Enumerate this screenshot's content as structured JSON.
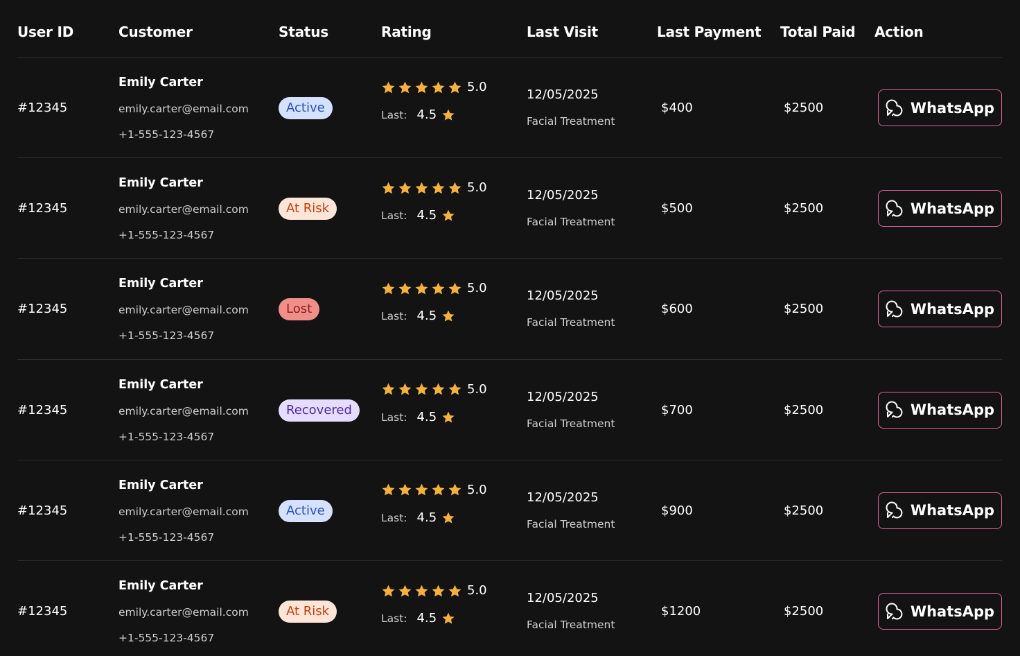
{
  "headers": {
    "user_id": "User ID",
    "customer": "Customer",
    "status": "Status",
    "rating": "Rating",
    "last_visit": "Last Visit",
    "last_payment": "Last Payment",
    "total_paid": "Total Paid",
    "action": "Action"
  },
  "status_styles": {
    "Active": {
      "bg": "#d5e2ff",
      "fg": "#2a4fb8"
    },
    "At Risk": {
      "bg": "#fde5d8",
      "fg": "#c2410c"
    },
    "Lost": {
      "bg": "#f08f8a",
      "fg": "#8b1d1d"
    },
    "Recovered": {
      "bg": "#e6dcff",
      "fg": "#4b2a9a"
    }
  },
  "colors": {
    "background": "#131313",
    "divider": "#2e2e2e",
    "star": "#f4b13e",
    "whatsapp_border": "#e0649b"
  },
  "rows": [
    {
      "user_id": "#12345",
      "name": "Emily Carter",
      "email": "emily.carter@email.com",
      "phone": "+1-555-123-4567",
      "status": "Active",
      "rating": "5.0",
      "last_label": "Last:",
      "last_rating": "4.5",
      "visit_date": "12/05/2025",
      "visit_type": "Facial Treatment",
      "last_payment": "$400",
      "total_paid": "$2500",
      "action_label": "WhatsApp",
      "action_icon": "whatsapp-icon"
    },
    {
      "user_id": "#12345",
      "name": "Emily Carter",
      "email": "emily.carter@email.com",
      "phone": "+1-555-123-4567",
      "status": "At Risk",
      "rating": "5.0",
      "last_label": "Last:",
      "last_rating": "4.5",
      "visit_date": "12/05/2025",
      "visit_type": "Facial Treatment",
      "last_payment": "$500",
      "total_paid": "$2500",
      "action_label": "WhatsApp",
      "action_icon": "whatsapp-icon"
    },
    {
      "user_id": "#12345",
      "name": "Emily Carter",
      "email": "emily.carter@email.com",
      "phone": "+1-555-123-4567",
      "status": "Lost",
      "rating": "5.0",
      "last_label": "Last:",
      "last_rating": "4.5",
      "visit_date": "12/05/2025",
      "visit_type": "Facial Treatment",
      "last_payment": "$600",
      "total_paid": "$2500",
      "action_label": "WhatsApp",
      "action_icon": "whatsapp-icon"
    },
    {
      "user_id": "#12345",
      "name": "Emily Carter",
      "email": "emily.carter@email.com",
      "phone": "+1-555-123-4567",
      "status": "Recovered",
      "rating": "5.0",
      "last_label": "Last:",
      "last_rating": "4.5",
      "visit_date": "12/05/2025",
      "visit_type": "Facial Treatment",
      "last_payment": "$700",
      "total_paid": "$2500",
      "action_label": "WhatsApp",
      "action_icon": "whatsapp-icon"
    },
    {
      "user_id": "#12345",
      "name": "Emily Carter",
      "email": "emily.carter@email.com",
      "phone": "+1-555-123-4567",
      "status": "Active",
      "rating": "5.0",
      "last_label": "Last:",
      "last_rating": "4.5",
      "visit_date": "12/05/2025",
      "visit_type": "Facial Treatment",
      "last_payment": "$900",
      "total_paid": "$2500",
      "action_label": "WhatsApp",
      "action_icon": "whatsapp-icon"
    },
    {
      "user_id": "#12345",
      "name": "Emily Carter",
      "email": "emily.carter@email.com",
      "phone": "+1-555-123-4567",
      "status": "At Risk",
      "rating": "5.0",
      "last_label": "Last:",
      "last_rating": "4.5",
      "visit_date": "12/05/2025",
      "visit_type": "Facial Treatment",
      "last_payment": "$1200",
      "total_paid": "$2500",
      "action_label": "WhatsApp",
      "action_icon": "whatsapp-icon"
    }
  ]
}
